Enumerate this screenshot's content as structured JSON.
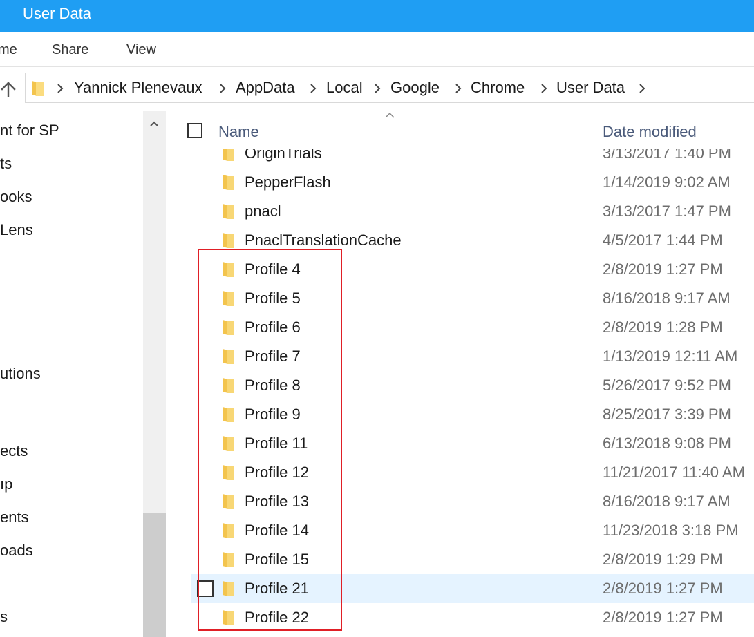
{
  "window": {
    "title": "User Data"
  },
  "ribbon": {
    "tabs": [
      "me",
      "Share",
      "View"
    ]
  },
  "address": {
    "crumbs": [
      "Yannick Plenevaux",
      "AppData",
      "Local",
      "Google",
      "Chrome",
      "User Data"
    ]
  },
  "nav": {
    "items": [
      "nt for SP",
      "ts",
      "ooks",
      "Lens",
      "utions",
      "ects",
      "ıp",
      "ents",
      "oads",
      "s"
    ]
  },
  "columns": {
    "name": "Name",
    "date_modified": "Date modified"
  },
  "files": [
    {
      "name": "OriginTrials",
      "date": "3/13/2017 1:40 PM"
    },
    {
      "name": "PepperFlash",
      "date": "1/14/2019 9:02 AM"
    },
    {
      "name": "pnacl",
      "date": "3/13/2017 1:47 PM"
    },
    {
      "name": "PnaclTranslationCache",
      "date": "4/5/2017 1:44 PM"
    },
    {
      "name": "Profile 4",
      "date": "2/8/2019 1:27 PM"
    },
    {
      "name": "Profile 5",
      "date": "8/16/2018 9:17 AM"
    },
    {
      "name": "Profile 6",
      "date": "2/8/2019 1:28 PM"
    },
    {
      "name": "Profile 7",
      "date": "1/13/2019 12:11 AM"
    },
    {
      "name": "Profile 8",
      "date": "5/26/2017 9:52 PM"
    },
    {
      "name": "Profile 9",
      "date": "8/25/2017 3:39 PM"
    },
    {
      "name": "Profile 11",
      "date": "6/13/2018 9:08 PM"
    },
    {
      "name": "Profile 12",
      "date": "11/21/2017 11:40 AM"
    },
    {
      "name": "Profile 13",
      "date": "8/16/2018 9:17 AM"
    },
    {
      "name": "Profile 14",
      "date": "11/23/2018 3:18 PM"
    },
    {
      "name": "Profile 15",
      "date": "2/8/2019 1:29 PM"
    },
    {
      "name": "Profile 21",
      "date": "2/8/2019 1:27 PM"
    },
    {
      "name": "Profile 22",
      "date": "2/8/2019 1:27 PM"
    }
  ],
  "hover_row": "Profile 21",
  "colors": {
    "titlebar": "#1f9ef3",
    "folder": "#f8d775",
    "highlight": "#e01f26",
    "hover": "#e5f3ff"
  },
  "icons": {
    "up": "arrow-up-icon",
    "folder": "folder-icon",
    "chevron": "chevron-right-icon",
    "sort": "sort-caret-icon"
  }
}
